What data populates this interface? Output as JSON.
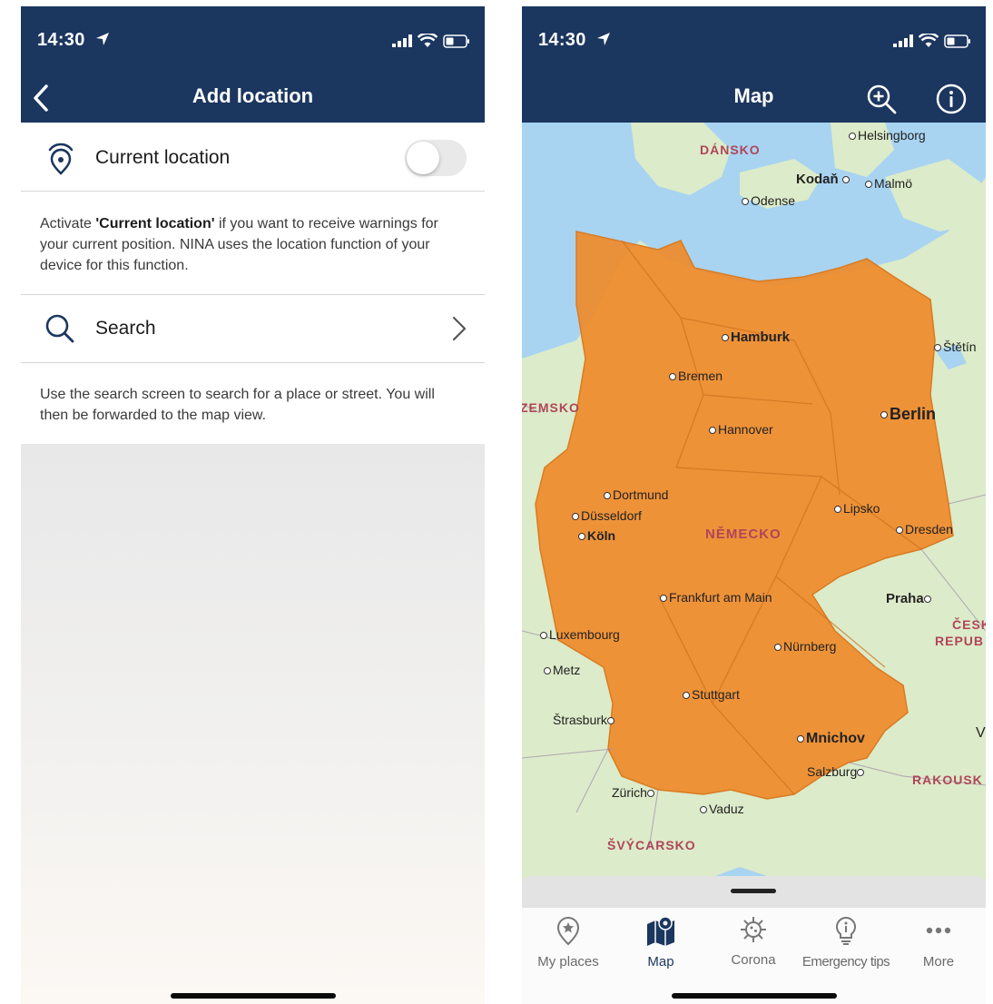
{
  "status": {
    "time": "14:30"
  },
  "add_location": {
    "title": "Add location",
    "current_location_label": "Current location",
    "current_location_on": false,
    "desc_prefix": "Activate ",
    "desc_bold": "'Current location'",
    "desc_suffix": " if you want to receive warnings for your current position. NINA uses the location function of your device for this function.",
    "search_label": "Search",
    "search_desc": "Use the search screen to search for a place or street. You will then be forwarded to the map view."
  },
  "map_screen": {
    "title": "Map",
    "labels": {
      "dansko": "DÁNSKO",
      "helsingborg": "Helsingborg",
      "kodan": "Kodaň",
      "malmo": "Malmö",
      "odense": "Odense",
      "hamburk": "Hamburk",
      "stetin": "Štětín",
      "bremen": "Bremen",
      "zemsko": "ZEMSKO",
      "hannover": "Hannover",
      "berlin": "Berlin",
      "dortmund": "Dortmund",
      "dusseldorf": "Düsseldorf",
      "koln": "Köln",
      "lipsko": "Lipsko",
      "nemecko": "NĚMECKO",
      "dresden": "Dresden",
      "frankfurt": "Frankfurt am Main",
      "praha": "Praha",
      "cesk": "ČESK",
      "repub": "REPUB",
      "luxembourg": "Luxembourg",
      "nurnberg": "Nürnberg",
      "metz": "Metz",
      "stuttgart": "Stuttgart",
      "strasburk": "Štrasburk",
      "v": "V",
      "mnichov": "Mnichov",
      "salzburg": "Salzburg",
      "rakousk": "RAKOUSK",
      "zurich": "Zürich",
      "vaduz": "Vaduz",
      "svycarsko": "ŠVÝCARSKO"
    },
    "tabs": [
      {
        "label": "My places",
        "icon": "location-star-icon"
      },
      {
        "label": "Map",
        "icon": "map-icon"
      },
      {
        "label": "Corona",
        "icon": "virus-icon"
      },
      {
        "label": "Emergency tips",
        "icon": "lightbulb-icon"
      },
      {
        "label": "More",
        "icon": "more-dots-icon"
      }
    ],
    "active_tab": "Map"
  },
  "colors": {
    "navbar": "#1b365f",
    "warning_fill": "#ef8a2b",
    "water": "#a8d4f2",
    "land": "#dcebc9"
  }
}
